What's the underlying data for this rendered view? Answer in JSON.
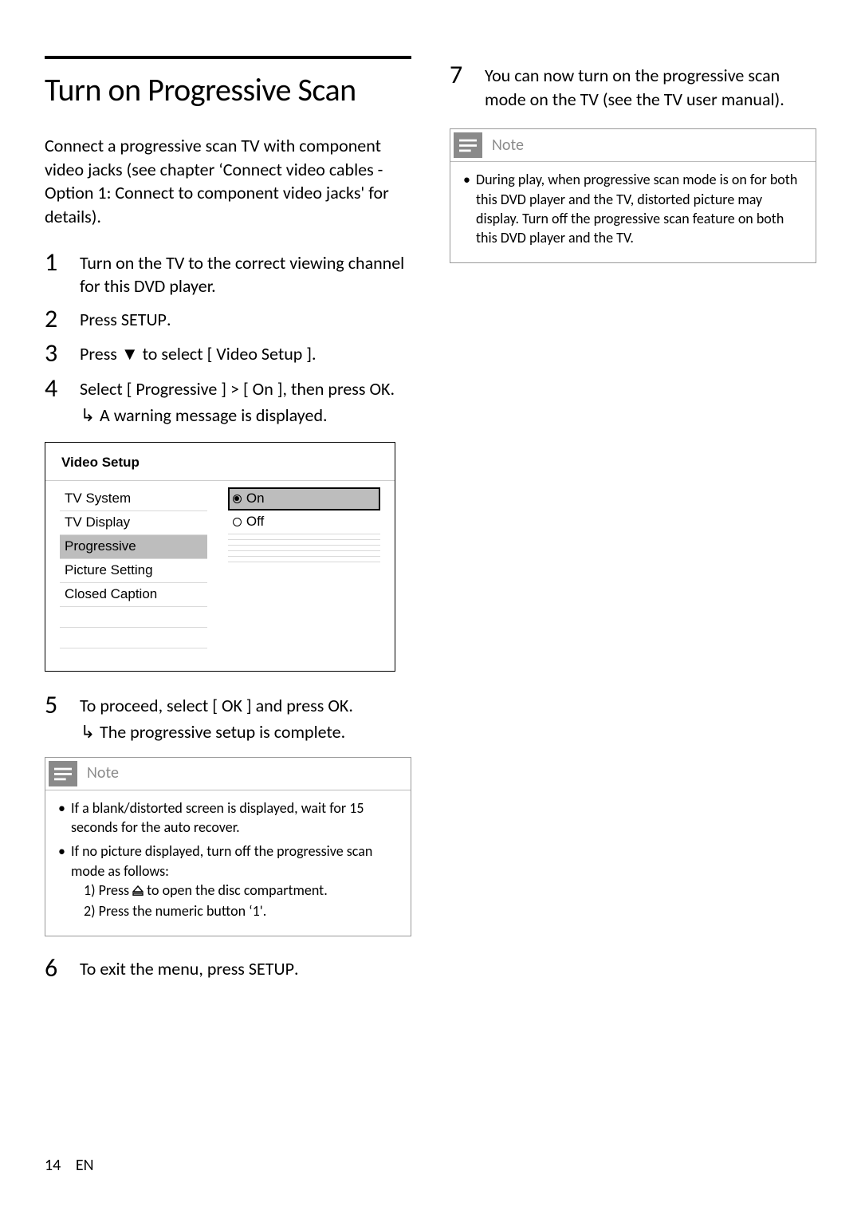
{
  "heading": "Turn on Progressive Scan",
  "intro": "Connect a progressive scan TV with component video jacks (see chapter ‘Connect video cables - Option 1: Connect to component video jacks' for details).",
  "steps": {
    "s1": "Turn on the TV to the correct viewing channel for this DVD player.",
    "s2_a": "Press ",
    "s2_b": "SETUP",
    "s2_c": ".",
    "s3_a": "Press ",
    "s3_b": "▼",
    "s3_c": " to select ",
    "s3_d": "[ Video Setup ]",
    "s3_e": ".",
    "s4_a": "Select ",
    "s4_b": "[ Progressive ]",
    "s4_c": " > ",
    "s4_d": "[ On ]",
    "s4_e": ", then press ",
    "s4_f": "OK",
    "s4_g": ".",
    "s4_result": "A warning message is displayed.",
    "s5_a": "To proceed, select ",
    "s5_b": "[ OK ]",
    "s5_c": " and press ",
    "s5_d": "OK",
    "s5_e": ".",
    "s5_result": "The progressive setup is complete.",
    "s6_a": "To exit the menu, press ",
    "s6_b": "SETUP",
    "s6_c": ".",
    "s7": "You can now turn on the progressive scan mode on the TV (see the TV user manual)."
  },
  "osd": {
    "title": "Video Setup",
    "left": [
      "TV System",
      "TV Display",
      "Progressive",
      "Picture Setting",
      "Closed Caption"
    ],
    "selected_left_index": 2,
    "options": [
      "On",
      "Off"
    ],
    "selected_option_index": 0
  },
  "note_label": "Note",
  "note1": {
    "li1": "If a blank/distorted screen is displayed, wait for 15 seconds for the auto recover.",
    "li2_a": "If no picture displayed, turn off the progressive scan mode as follows:",
    "li2_b1_a": "1)  Press ",
    "li2_b1_b": " to open the disc compartment.",
    "li2_b2_a": "2)  Press the ",
    "li2_b2_b": "numeric button ‘1'",
    "li2_b2_c": "."
  },
  "note2": {
    "li1": "During play, when progressive scan mode is on for both this DVD player and the TV, distorted picture may display. Turn off the progressive scan feature on both this DVD player and the TV."
  },
  "footer": {
    "page": "14",
    "lang": "EN"
  }
}
